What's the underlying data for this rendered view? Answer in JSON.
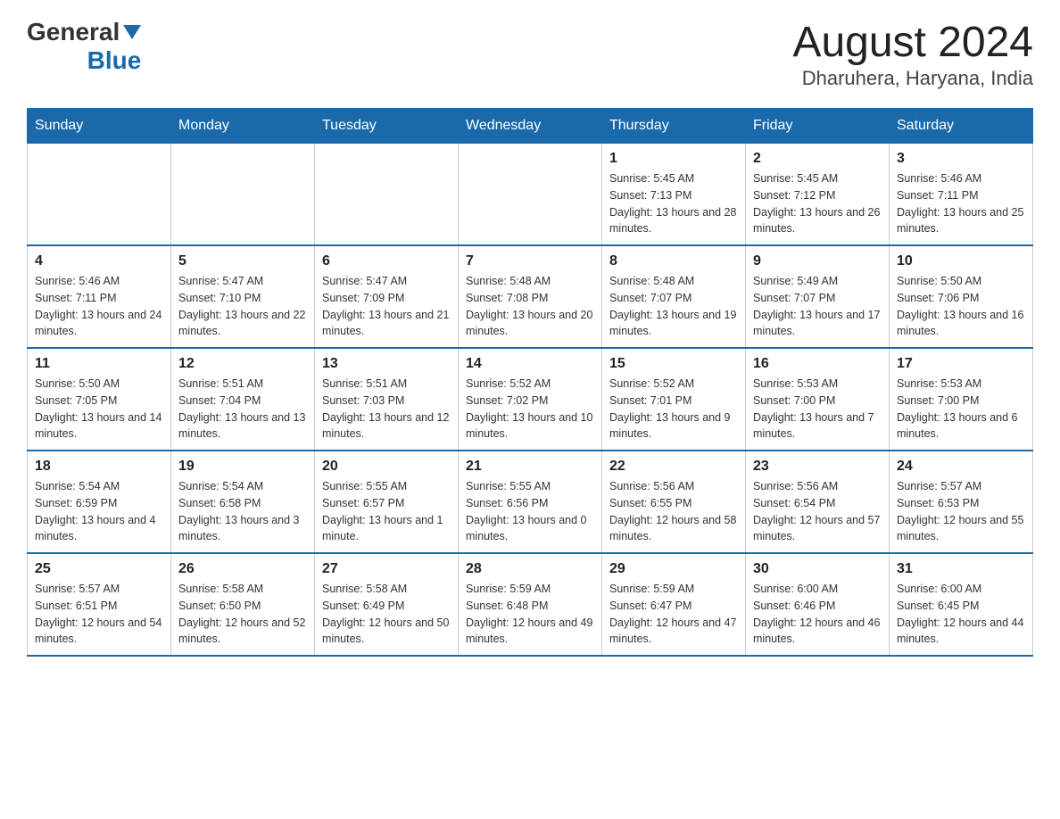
{
  "header": {
    "logo_general": "General",
    "logo_blue": "Blue",
    "title": "August 2024",
    "subtitle": "Dharuhera, Haryana, India"
  },
  "weekdays": [
    "Sunday",
    "Monday",
    "Tuesday",
    "Wednesday",
    "Thursday",
    "Friday",
    "Saturday"
  ],
  "weeks": [
    [
      {
        "day": "",
        "info": ""
      },
      {
        "day": "",
        "info": ""
      },
      {
        "day": "",
        "info": ""
      },
      {
        "day": "",
        "info": ""
      },
      {
        "day": "1",
        "info": "Sunrise: 5:45 AM\nSunset: 7:13 PM\nDaylight: 13 hours and 28 minutes."
      },
      {
        "day": "2",
        "info": "Sunrise: 5:45 AM\nSunset: 7:12 PM\nDaylight: 13 hours and 26 minutes."
      },
      {
        "day": "3",
        "info": "Sunrise: 5:46 AM\nSunset: 7:11 PM\nDaylight: 13 hours and 25 minutes."
      }
    ],
    [
      {
        "day": "4",
        "info": "Sunrise: 5:46 AM\nSunset: 7:11 PM\nDaylight: 13 hours and 24 minutes."
      },
      {
        "day": "5",
        "info": "Sunrise: 5:47 AM\nSunset: 7:10 PM\nDaylight: 13 hours and 22 minutes."
      },
      {
        "day": "6",
        "info": "Sunrise: 5:47 AM\nSunset: 7:09 PM\nDaylight: 13 hours and 21 minutes."
      },
      {
        "day": "7",
        "info": "Sunrise: 5:48 AM\nSunset: 7:08 PM\nDaylight: 13 hours and 20 minutes."
      },
      {
        "day": "8",
        "info": "Sunrise: 5:48 AM\nSunset: 7:07 PM\nDaylight: 13 hours and 19 minutes."
      },
      {
        "day": "9",
        "info": "Sunrise: 5:49 AM\nSunset: 7:07 PM\nDaylight: 13 hours and 17 minutes."
      },
      {
        "day": "10",
        "info": "Sunrise: 5:50 AM\nSunset: 7:06 PM\nDaylight: 13 hours and 16 minutes."
      }
    ],
    [
      {
        "day": "11",
        "info": "Sunrise: 5:50 AM\nSunset: 7:05 PM\nDaylight: 13 hours and 14 minutes."
      },
      {
        "day": "12",
        "info": "Sunrise: 5:51 AM\nSunset: 7:04 PM\nDaylight: 13 hours and 13 minutes."
      },
      {
        "day": "13",
        "info": "Sunrise: 5:51 AM\nSunset: 7:03 PM\nDaylight: 13 hours and 12 minutes."
      },
      {
        "day": "14",
        "info": "Sunrise: 5:52 AM\nSunset: 7:02 PM\nDaylight: 13 hours and 10 minutes."
      },
      {
        "day": "15",
        "info": "Sunrise: 5:52 AM\nSunset: 7:01 PM\nDaylight: 13 hours and 9 minutes."
      },
      {
        "day": "16",
        "info": "Sunrise: 5:53 AM\nSunset: 7:00 PM\nDaylight: 13 hours and 7 minutes."
      },
      {
        "day": "17",
        "info": "Sunrise: 5:53 AM\nSunset: 7:00 PM\nDaylight: 13 hours and 6 minutes."
      }
    ],
    [
      {
        "day": "18",
        "info": "Sunrise: 5:54 AM\nSunset: 6:59 PM\nDaylight: 13 hours and 4 minutes."
      },
      {
        "day": "19",
        "info": "Sunrise: 5:54 AM\nSunset: 6:58 PM\nDaylight: 13 hours and 3 minutes."
      },
      {
        "day": "20",
        "info": "Sunrise: 5:55 AM\nSunset: 6:57 PM\nDaylight: 13 hours and 1 minute."
      },
      {
        "day": "21",
        "info": "Sunrise: 5:55 AM\nSunset: 6:56 PM\nDaylight: 13 hours and 0 minutes."
      },
      {
        "day": "22",
        "info": "Sunrise: 5:56 AM\nSunset: 6:55 PM\nDaylight: 12 hours and 58 minutes."
      },
      {
        "day": "23",
        "info": "Sunrise: 5:56 AM\nSunset: 6:54 PM\nDaylight: 12 hours and 57 minutes."
      },
      {
        "day": "24",
        "info": "Sunrise: 5:57 AM\nSunset: 6:53 PM\nDaylight: 12 hours and 55 minutes."
      }
    ],
    [
      {
        "day": "25",
        "info": "Sunrise: 5:57 AM\nSunset: 6:51 PM\nDaylight: 12 hours and 54 minutes."
      },
      {
        "day": "26",
        "info": "Sunrise: 5:58 AM\nSunset: 6:50 PM\nDaylight: 12 hours and 52 minutes."
      },
      {
        "day": "27",
        "info": "Sunrise: 5:58 AM\nSunset: 6:49 PM\nDaylight: 12 hours and 50 minutes."
      },
      {
        "day": "28",
        "info": "Sunrise: 5:59 AM\nSunset: 6:48 PM\nDaylight: 12 hours and 49 minutes."
      },
      {
        "day": "29",
        "info": "Sunrise: 5:59 AM\nSunset: 6:47 PM\nDaylight: 12 hours and 47 minutes."
      },
      {
        "day": "30",
        "info": "Sunrise: 6:00 AM\nSunset: 6:46 PM\nDaylight: 12 hours and 46 minutes."
      },
      {
        "day": "31",
        "info": "Sunrise: 6:00 AM\nSunset: 6:45 PM\nDaylight: 12 hours and 44 minutes."
      }
    ]
  ]
}
